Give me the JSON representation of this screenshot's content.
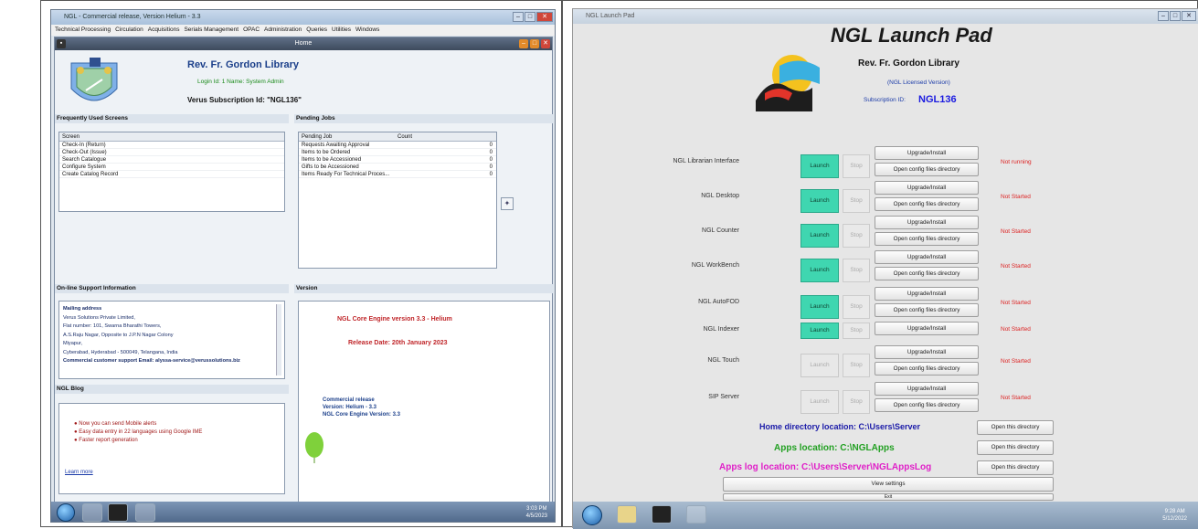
{
  "left": {
    "window_title": "NGL - Commercial release, Version Helium - 3.3",
    "menu": [
      "Technical Processing",
      "Circulation",
      "Acquisitions",
      "Serials Management",
      "OPAC",
      "Administration",
      "Queries",
      "Utilities",
      "Windows"
    ],
    "inner_title": "Home",
    "library_name": "Rev. Fr. Gordon Library",
    "login_line": "Login Id: 1   Name: System Admin",
    "subscription": "Verus Subscription Id: \"NGL136\"",
    "frequent_header": "Frequently Used Screens",
    "frequent_col": "Screen",
    "frequent_items": [
      "Check-In (Return)",
      "Check-Out (Issue)",
      "Search Catalogue",
      "Configure System",
      "Create Catalog Record"
    ],
    "pending_header": "Pending Jobs",
    "pending_cols": [
      "Pending Job",
      "Count"
    ],
    "pending_rows": [
      {
        "job": "Requests Awaiting Approval",
        "count": "0"
      },
      {
        "job": "Items to be Ordered",
        "count": "0"
      },
      {
        "job": "Items to be Accessioned",
        "count": "0"
      },
      {
        "job": "Gifts to be Accessioned",
        "count": "0"
      },
      {
        "job": "Items Ready For Technical Proces...",
        "count": "0"
      }
    ],
    "support_header": "On-line Support Information",
    "support_lines": [
      "Mailing address",
      "Verus Solutions Private Limited,",
      "Flat number: 101, Swarna Bharathi Towers,",
      "A.S.Raju Nagar, Opposite to J.P.N Nagar Colony",
      "Miyapur,",
      "Cyberabad, Hyderabad - 500049, Telangana, India",
      "Commercial customer support Email: alyssa-service@verussolutions.biz"
    ],
    "version_header": "Version",
    "version_engine": "NGL Core Engine version 3.3 - Helium",
    "release_date": "Release Date: 20th January 2023",
    "release_lines": [
      "Commercial release",
      "Version: Helium - 3.3",
      "NGL Core Engine Version: 3.3"
    ],
    "blog_header": "NGL Blog",
    "blog_items": [
      "Now you can send Mobile alerts",
      "Easy data entry in 22 languages using Google IME",
      "Faster report generation"
    ],
    "learn_more": "Learn more",
    "clock": [
      "3:03 PM",
      "4/5/2023"
    ]
  },
  "right": {
    "window_title": "NGL Launch Pad",
    "app_title": "NGL Launch Pad",
    "library_name": "Rev. Fr. Gordon Library",
    "licensed": "(NGL Licensed Version)",
    "subscription_label": "Subscription ID:",
    "subscription_id": "NGL136",
    "launch_label": "Launch",
    "stop_label": "Stop",
    "upgrade_label": "Upgrade/Install",
    "config_label": "Open config files directory",
    "apps": [
      {
        "name": "NGL Librarian Interface",
        "status": "Not running",
        "enabled": true,
        "config": true
      },
      {
        "name": "NGL Desktop",
        "status": "Not Started",
        "enabled": true,
        "config": true
      },
      {
        "name": "NGL Counter",
        "status": "Not Started",
        "enabled": true,
        "config": true
      },
      {
        "name": "NGL WorkBench",
        "status": "Not Started",
        "enabled": true,
        "config": true
      },
      {
        "name": "NGL AutoFOD",
        "status": "Not Started",
        "enabled": true,
        "config": true
      },
      {
        "name": "NGL Indexer",
        "status": "Not Started",
        "enabled": true,
        "config": false
      },
      {
        "name": "NGL Touch",
        "status": "Not Started",
        "enabled": false,
        "config": true
      },
      {
        "name": "SIP Server",
        "status": "Not Started",
        "enabled": false,
        "config": true
      }
    ],
    "home_dir": "Home directory location: C:\\Users\\Server",
    "apps_loc": "Apps location: C:\\NGLApps",
    "log_loc": "Apps log location: C:\\Users\\Server\\NGLAppsLog",
    "open_dir": "Open this directory",
    "view_settings": "View settings",
    "exit": "Exit",
    "clock": [
      "9:28 AM",
      "5/12/2022"
    ]
  },
  "colors": {
    "launch": "#3fd6b0",
    "status": "#dd2222",
    "home_dir": "#1a1aa8",
    "apps_loc": "#22a022",
    "log_loc": "#e020c8"
  }
}
